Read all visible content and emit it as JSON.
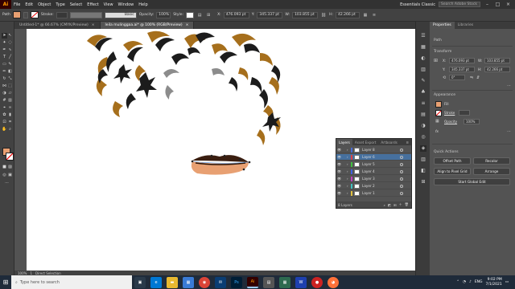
{
  "app": {
    "logo": "Ai"
  },
  "menu": [
    "File",
    "Edit",
    "Object",
    "Type",
    "Select",
    "Effect",
    "View",
    "Window",
    "Help"
  ],
  "workspace": "Essentials Classic",
  "search": {
    "placeholder": "Search Adobe Stock"
  },
  "controlbar": {
    "selection_type": "Path",
    "stroke_label": "Stroke:",
    "brush_label": "Basic",
    "opacity_label": "Opacity:",
    "opacity_value": "100%",
    "style_label": "Style:",
    "x_value": "476.093 pt",
    "y_value": "345.337 pt",
    "w_value": "103.855 pt",
    "h_value": "42.266 pt",
    "fill_color": "#e8a072"
  },
  "tabs": [
    {
      "label": "Untitled-1* @ 66.67% (CMYK/Preview)",
      "close": "×"
    },
    {
      "label": "leila mulinggaa.ai* @ 100% (RGB/Preview)",
      "close": "×"
    }
  ],
  "layers_panel": {
    "tabs": [
      "Layers",
      "Asset Export",
      "Artboards"
    ],
    "rows": [
      {
        "name": "Layer 8",
        "color": "#4a6cd4"
      },
      {
        "name": "Layer 6",
        "color": "#e04040"
      },
      {
        "name": "Layer 5",
        "color": "#40c040"
      },
      {
        "name": "Layer 4",
        "color": "#4060e0"
      },
      {
        "name": "Layer 3",
        "color": "#c040c0"
      },
      {
        "name": "Layer 2",
        "color": "#40c0c0"
      },
      {
        "name": "Layer 1",
        "color": "#e0c040"
      }
    ],
    "selected_row": 1,
    "footer": "8 Layers"
  },
  "properties": {
    "tabs": [
      "Properties",
      "Libraries"
    ],
    "path_label": "Path",
    "transform_title": "Transform",
    "x_label": "X:",
    "x_value": "476.093 pt",
    "y_label": "Y:",
    "y_value": "345.337 pt",
    "w_label": "W:",
    "w_value": "103.855 pt",
    "h_label": "H:",
    "h_value": "42.266 pt",
    "angle_value": "0°",
    "appearance_title": "Appearance",
    "fill_label": "Fill",
    "stroke_label": "Stroke",
    "opacity_label": "Opacity",
    "opacity_value": "100%",
    "fx_label": "fx",
    "quick_actions_title": "Quick Actions",
    "btn_offset": "Offset Path",
    "btn_recolor": "Recolor",
    "btn_align_pixel": "Align to Pixel Grid",
    "btn_arrange": "Arrange",
    "btn_global_edit": "Start Global Edit"
  },
  "status": {
    "zoom": "100%",
    "tool": "Direct Selection",
    "page": "1"
  },
  "taskbar": {
    "search_placeholder": "Type here to search",
    "time": "9:02 PM",
    "date": "7/1/2021",
    "lang": "ENG"
  }
}
